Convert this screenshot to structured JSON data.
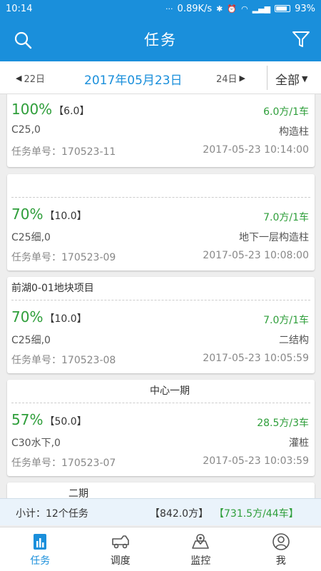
{
  "status": {
    "time": "10:14",
    "speed": "0.89K/s",
    "battery": "93%"
  },
  "header": {
    "title": "任务"
  },
  "datebar": {
    "prev": "22日",
    "current": "2017年05月23日",
    "next": "24日",
    "filter": "全部"
  },
  "tasks": [
    {
      "project": "",
      "percent": "100%",
      "qty": "【6.0】",
      "delivered": "6.0方/1车",
      "grade": "C25,0",
      "part": "构造柱",
      "order_no": "任务单号：170523-11",
      "time": "2017-05-23 10:14:00"
    },
    {
      "project": "",
      "percent": "70%",
      "qty": "【10.0】",
      "delivered": "7.0方/1车",
      "grade": "C25细,0",
      "part": "地下一层构造柱",
      "order_no": "任务单号：170523-09",
      "time": "2017-05-23 10:08:00"
    },
    {
      "project": "前湖0-01地块项目",
      "percent": "70%",
      "qty": "【10.0】",
      "delivered": "7.0方/1车",
      "grade": "C25细,0",
      "part": "二结构",
      "order_no": "任务单号：170523-08",
      "time": "2017-05-23 10:05:59"
    },
    {
      "project": "中心一期",
      "percent": "57%",
      "qty": "【50.0】",
      "delivered": "28.5方/3车",
      "grade": "C30水下,0",
      "part": "灌桩",
      "order_no": "任务单号：170523-07",
      "time": "2017-05-23 10:03:59"
    },
    {
      "project": "二期"
    }
  ],
  "summary": {
    "label": "小计：12个任务",
    "total": "【842.0方】",
    "delivered_total": "【731.5方/44车】"
  },
  "tabs": [
    {
      "label": "任务",
      "icon": "task-chart-icon"
    },
    {
      "label": "调度",
      "icon": "truck-icon"
    },
    {
      "label": "监控",
      "icon": "map-icon"
    },
    {
      "label": "我",
      "icon": "user-icon"
    }
  ],
  "colors": {
    "primary": "#1a8fdb",
    "progress_green": "#2e9e3a"
  }
}
